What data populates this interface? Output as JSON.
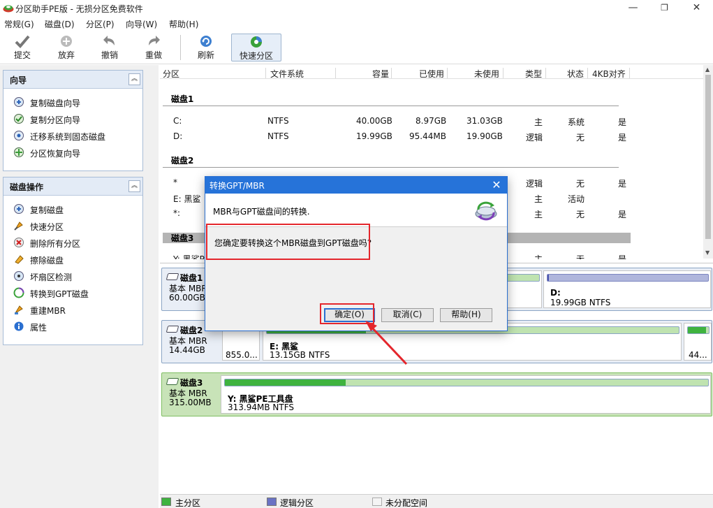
{
  "window": {
    "title": "分区助手PE版 - 无损分区免费软件",
    "min": "—",
    "max": "❐",
    "close": "✕"
  },
  "menu": [
    "常规(G)",
    "磁盘(D)",
    "分区(P)",
    "向导(W)",
    "帮助(H)"
  ],
  "toolbar": {
    "commit": "提交",
    "discard": "放弃",
    "undo": "撤销",
    "redo": "重做",
    "refresh": "刷新",
    "quick_partition": "快速分区"
  },
  "wizard_panel": {
    "title": "向导",
    "items": [
      "复制磁盘向导",
      "复制分区向导",
      "迁移系统到固态磁盘",
      "分区恢复向导"
    ]
  },
  "disk_ops_panel": {
    "title": "磁盘操作",
    "items": [
      "复制磁盘",
      "快速分区",
      "删除所有分区",
      "擦除磁盘",
      "坏扇区检测",
      "转换到GPT磁盘",
      "重建MBR",
      "属性"
    ]
  },
  "table": {
    "columns": [
      "分区",
      "文件系统",
      "容量",
      "已使用",
      "未使用",
      "类型",
      "状态",
      "4KB对齐"
    ],
    "disk1": {
      "label": "磁盘1",
      "rows": [
        [
          "C:",
          "NTFS",
          "40.00GB",
          "8.97GB",
          "31.03GB",
          "主",
          "系统",
          "是"
        ],
        [
          "D:",
          "NTFS",
          "19.99GB",
          "95.44MB",
          "19.90GB",
          "逻辑",
          "无",
          "是"
        ]
      ]
    },
    "disk2": {
      "label": "磁盘2",
      "rows": [
        [
          "*",
          "",
          "",
          "",
          "",
          "逻辑",
          "无",
          "是"
        ],
        [
          "E: 黑鲨",
          "",
          "",
          "",
          "",
          "主",
          "活动",
          ""
        ],
        [
          "*:",
          "",
          "",
          "",
          "",
          "主",
          "无",
          "是"
        ]
      ]
    },
    "disk3": {
      "label": "磁盘3",
      "rows": [
        [
          "Y: 黑鲨P",
          "",
          "",
          "",
          "",
          "主",
          "无",
          "是"
        ]
      ]
    }
  },
  "disks": [
    {
      "name": "磁盘1",
      "type": "基本 MBR",
      "size": "60.00GB",
      "partitions": [
        {
          "name": "D:",
          "detail": "19.99GB NTFS",
          "used": 0.01
        }
      ]
    },
    {
      "name": "磁盘2",
      "type": "基本 MBR",
      "size": "14.44GB",
      "partitions": [
        {
          "name": "",
          "detail": "855.0..."
        },
        {
          "name": "E: 黑鲨",
          "detail": "13.15GB NTFS"
        },
        {
          "name": "",
          "detail": "44..."
        }
      ]
    },
    {
      "name": "磁盘3",
      "type": "基本 MBR",
      "size": "315.00MB",
      "partitions": [
        {
          "name": "Y: 黑鲨PE工具盘",
          "detail": "313.94MB NTFS",
          "used": 0.25
        }
      ]
    }
  ],
  "legend": {
    "primary": "主分区",
    "logical": "逻辑分区",
    "unallocated": "未分配空间"
  },
  "dialog": {
    "title": "转换GPT/MBR",
    "close": "✕",
    "header": "MBR与GPT磁盘间的转换.",
    "question": "您确定要转换这个MBR磁盘到GPT磁盘吗?",
    "ok": "确定(O)",
    "cancel": "取消(C)",
    "help": "帮助(H)"
  },
  "colors": {
    "accent": "#2673d9",
    "highlight": "#e4262c",
    "primary_partition": "#3fb33f",
    "logical_partition": "#7d86c0"
  }
}
